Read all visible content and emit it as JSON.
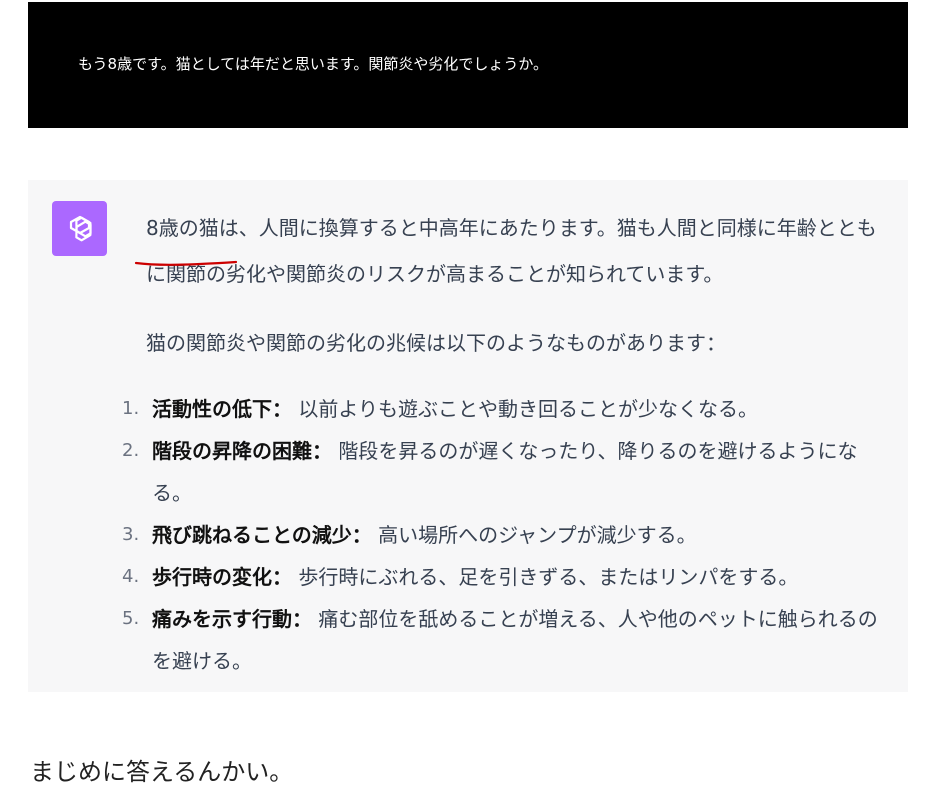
{
  "user_message": "もう8歳です。猫としては年だと思います。関節炎や劣化でしょうか。",
  "assistant": {
    "avatar_icon": "openai-logo-icon",
    "avatar_color": "#ab68ff",
    "para1": "8歳の猫は、人間に換算すると中高年にあたります。猫も人間と同様に年齢とともに関節の劣化や関節炎のリスクが高まることが知られています。",
    "para2": "猫の関節炎や関節の劣化の兆候は以下のようなものがあります：",
    "items": [
      {
        "num": "1.",
        "title": "活動性の低下：",
        "text": "以前よりも遊ぶことや動き回ることが少なくなる。"
      },
      {
        "num": "2.",
        "title": "階段の昇降の困難：",
        "text": "階段を昇るのが遅くなったり、降りるのを避けるようになる。"
      },
      {
        "num": "3.",
        "title": "飛び跳ねることの減少：",
        "text": "高い場所へのジャンプが減少する。"
      },
      {
        "num": "4.",
        "title": "歩行時の変化：",
        "text": "歩行時にぶれる、足を引きずる、またはリンパをする。"
      },
      {
        "num": "5.",
        "title": "痛みを示す行動：",
        "text": "痛む部位を舐めることが増える、人や他のペットに触られるのを避ける。"
      }
    ],
    "underline_color": "#cc0000"
  },
  "footer_comment": "まじめに答えるんかい。"
}
